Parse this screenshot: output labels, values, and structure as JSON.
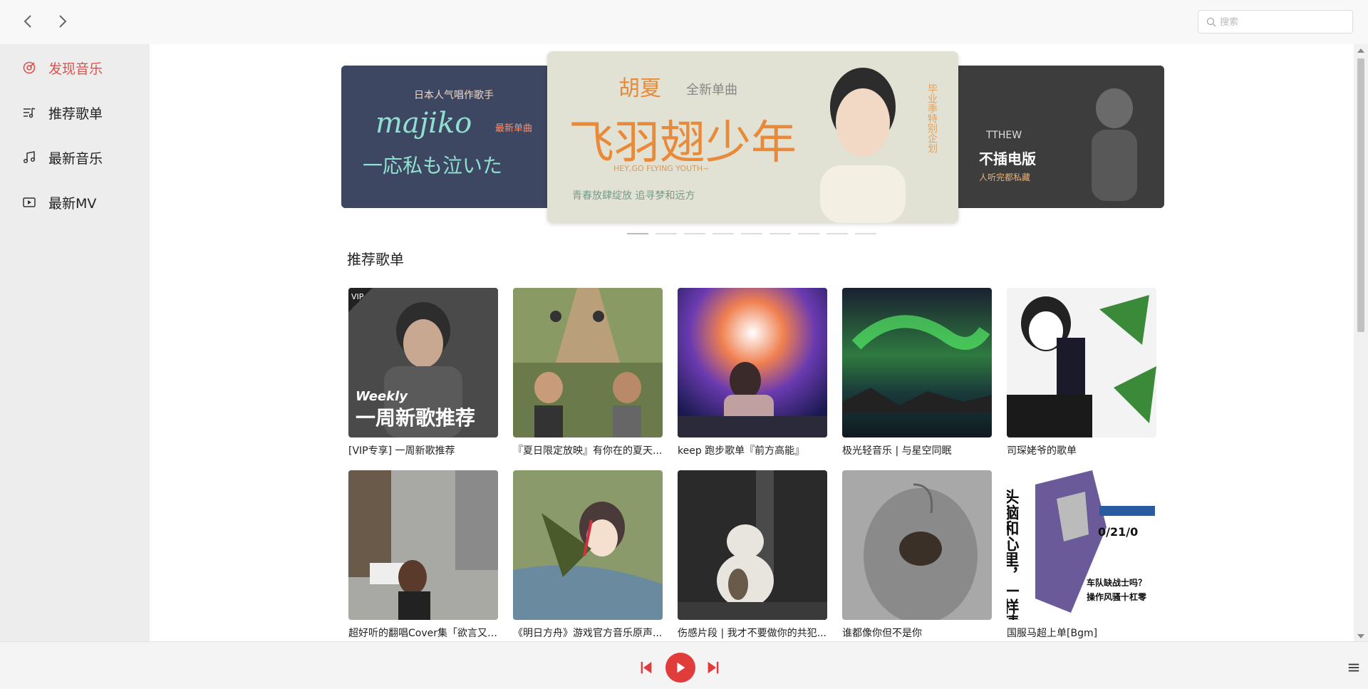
{
  "search": {
    "placeholder": "搜索"
  },
  "sidebar": {
    "items": [
      {
        "label": "发现音乐",
        "icon": "discover-icon",
        "active": true
      },
      {
        "label": "推荐歌单",
        "icon": "playlist-icon",
        "active": false
      },
      {
        "label": "最新音乐",
        "icon": "music-note-icon",
        "active": false
      },
      {
        "label": "最新MV",
        "icon": "video-icon",
        "active": false
      }
    ]
  },
  "banner": {
    "left": {
      "line1": "日本人气唱作歌手",
      "line2": "majiko",
      "tag": "最新单曲",
      "line3": "一応私も泣いた"
    },
    "center": {
      "artist": "胡夏",
      "tag": "全新单曲",
      "title": "飞羽翅少年",
      "en": "HEY,GO FLYING YOUTH~",
      "slogan": "青春放肆绽放  追寻梦和远方",
      "side": "毕业季特别企划"
    },
    "right": {
      "line1": "TTHEW",
      "line2": "不插电版",
      "line3": "人听完都私藏"
    },
    "dot_count": 9,
    "active_dot": 0
  },
  "section": {
    "title": "推荐歌单"
  },
  "playlists": [
    {
      "title": "[VIP专享] 一周新歌推荐",
      "vip": true,
      "cover_text1": "Weekly",
      "cover_text2": "一周新歌推荐",
      "color": "#4a4a4a"
    },
    {
      "title": "『夏日限定放映』有你在的夏天...",
      "color": "#7a8a55"
    },
    {
      "title": "keep 跑步歌单『前方高能』",
      "color": "#4a3a8a"
    },
    {
      "title": "极光轻音乐 | 与星空同眠",
      "color": "#1f3a2a"
    },
    {
      "title": "司琛姥爷的歌单",
      "color": "#eeeeee"
    },
    {
      "title": "超好听的翻唱Cover集「欲言又止...",
      "color": "#8a8a88"
    },
    {
      "title": "《明日方舟》游戏官方音乐原声...",
      "color": "#5a6a4a"
    },
    {
      "title": "伤感片段 | 我才不要做你的共犯...",
      "color": "#2a2a2a"
    },
    {
      "title": "谁都像你但不是你",
      "color": "#9a9a9a"
    },
    {
      "title": "国服马超上单[Bgm]",
      "cover_text1": "头脑和心里，一样清楚",
      "cover_text2": "0/21/0",
      "cover_text3": "车队缺战士吗？",
      "cover_text4": "操作风骚十杠零",
      "color": "#ffffff"
    }
  ],
  "colors": {
    "accent": "#d9534f",
    "play": "#e03c3c"
  }
}
